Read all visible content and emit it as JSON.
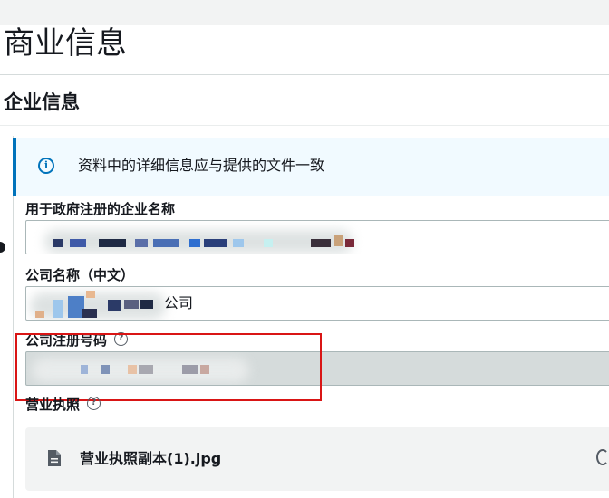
{
  "page": {
    "title": "商业信息"
  },
  "section": {
    "title": "企业信息"
  },
  "alert": {
    "icon": "info-icon",
    "text": "资料中的详细信息应与提供的文件一致"
  },
  "fields": {
    "gov_name": {
      "label": "用于政府注册的企业名称",
      "value": ""
    },
    "cn_name": {
      "label": "公司名称（中文）",
      "value_suffix": "公司"
    },
    "reg_number": {
      "label": "公司注册号码",
      "help_icon": "help-icon",
      "value": ""
    },
    "license": {
      "label": "营业执照",
      "help_icon": "help-icon",
      "file_icon": "document-icon",
      "file_name": "营业执照副本(1).jpg"
    }
  },
  "colors": {
    "accent": "#0073bb",
    "highlight": "#d91515",
    "alert_bg": "#f1faff",
    "disabled_bg": "#d5dbdb"
  }
}
